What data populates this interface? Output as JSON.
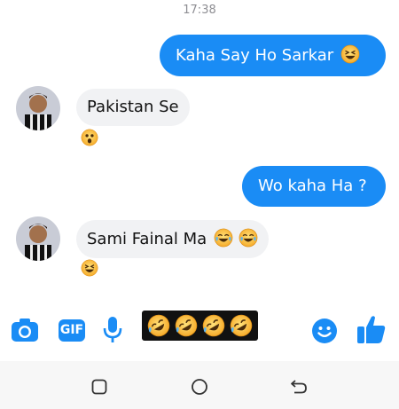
{
  "status_time": "17:38",
  "messages": {
    "m1": {
      "text": "Kaha Say Ho Sarkar",
      "emoji": "squinting-laughing-face"
    },
    "m2": {
      "text": "Pakistan Se",
      "reaction": "surprised-face"
    },
    "m3": {
      "text": "Wo kaha Ha ?"
    },
    "m4": {
      "text": "Sami Fainal Ma",
      "emoji": [
        "tears-of-joy-face",
        "tears-of-joy-face"
      ],
      "reaction": "grinning-face"
    }
  },
  "composer": {
    "icons": [
      "camera-icon",
      "gif-icon",
      "microphone-icon",
      "emoji-icon",
      "thumbs-up-icon"
    ],
    "gif_label": "GIF",
    "emoji_strip": [
      "rolling-laughing-face",
      "rolling-laughing-face",
      "rolling-laughing-face",
      "rolling-laughing-face"
    ]
  },
  "colors": {
    "accent": "#1a8cf5",
    "bubble_in": "#f1f2f4"
  },
  "navigation": [
    "recent-apps-button",
    "home-button",
    "back-button"
  ]
}
